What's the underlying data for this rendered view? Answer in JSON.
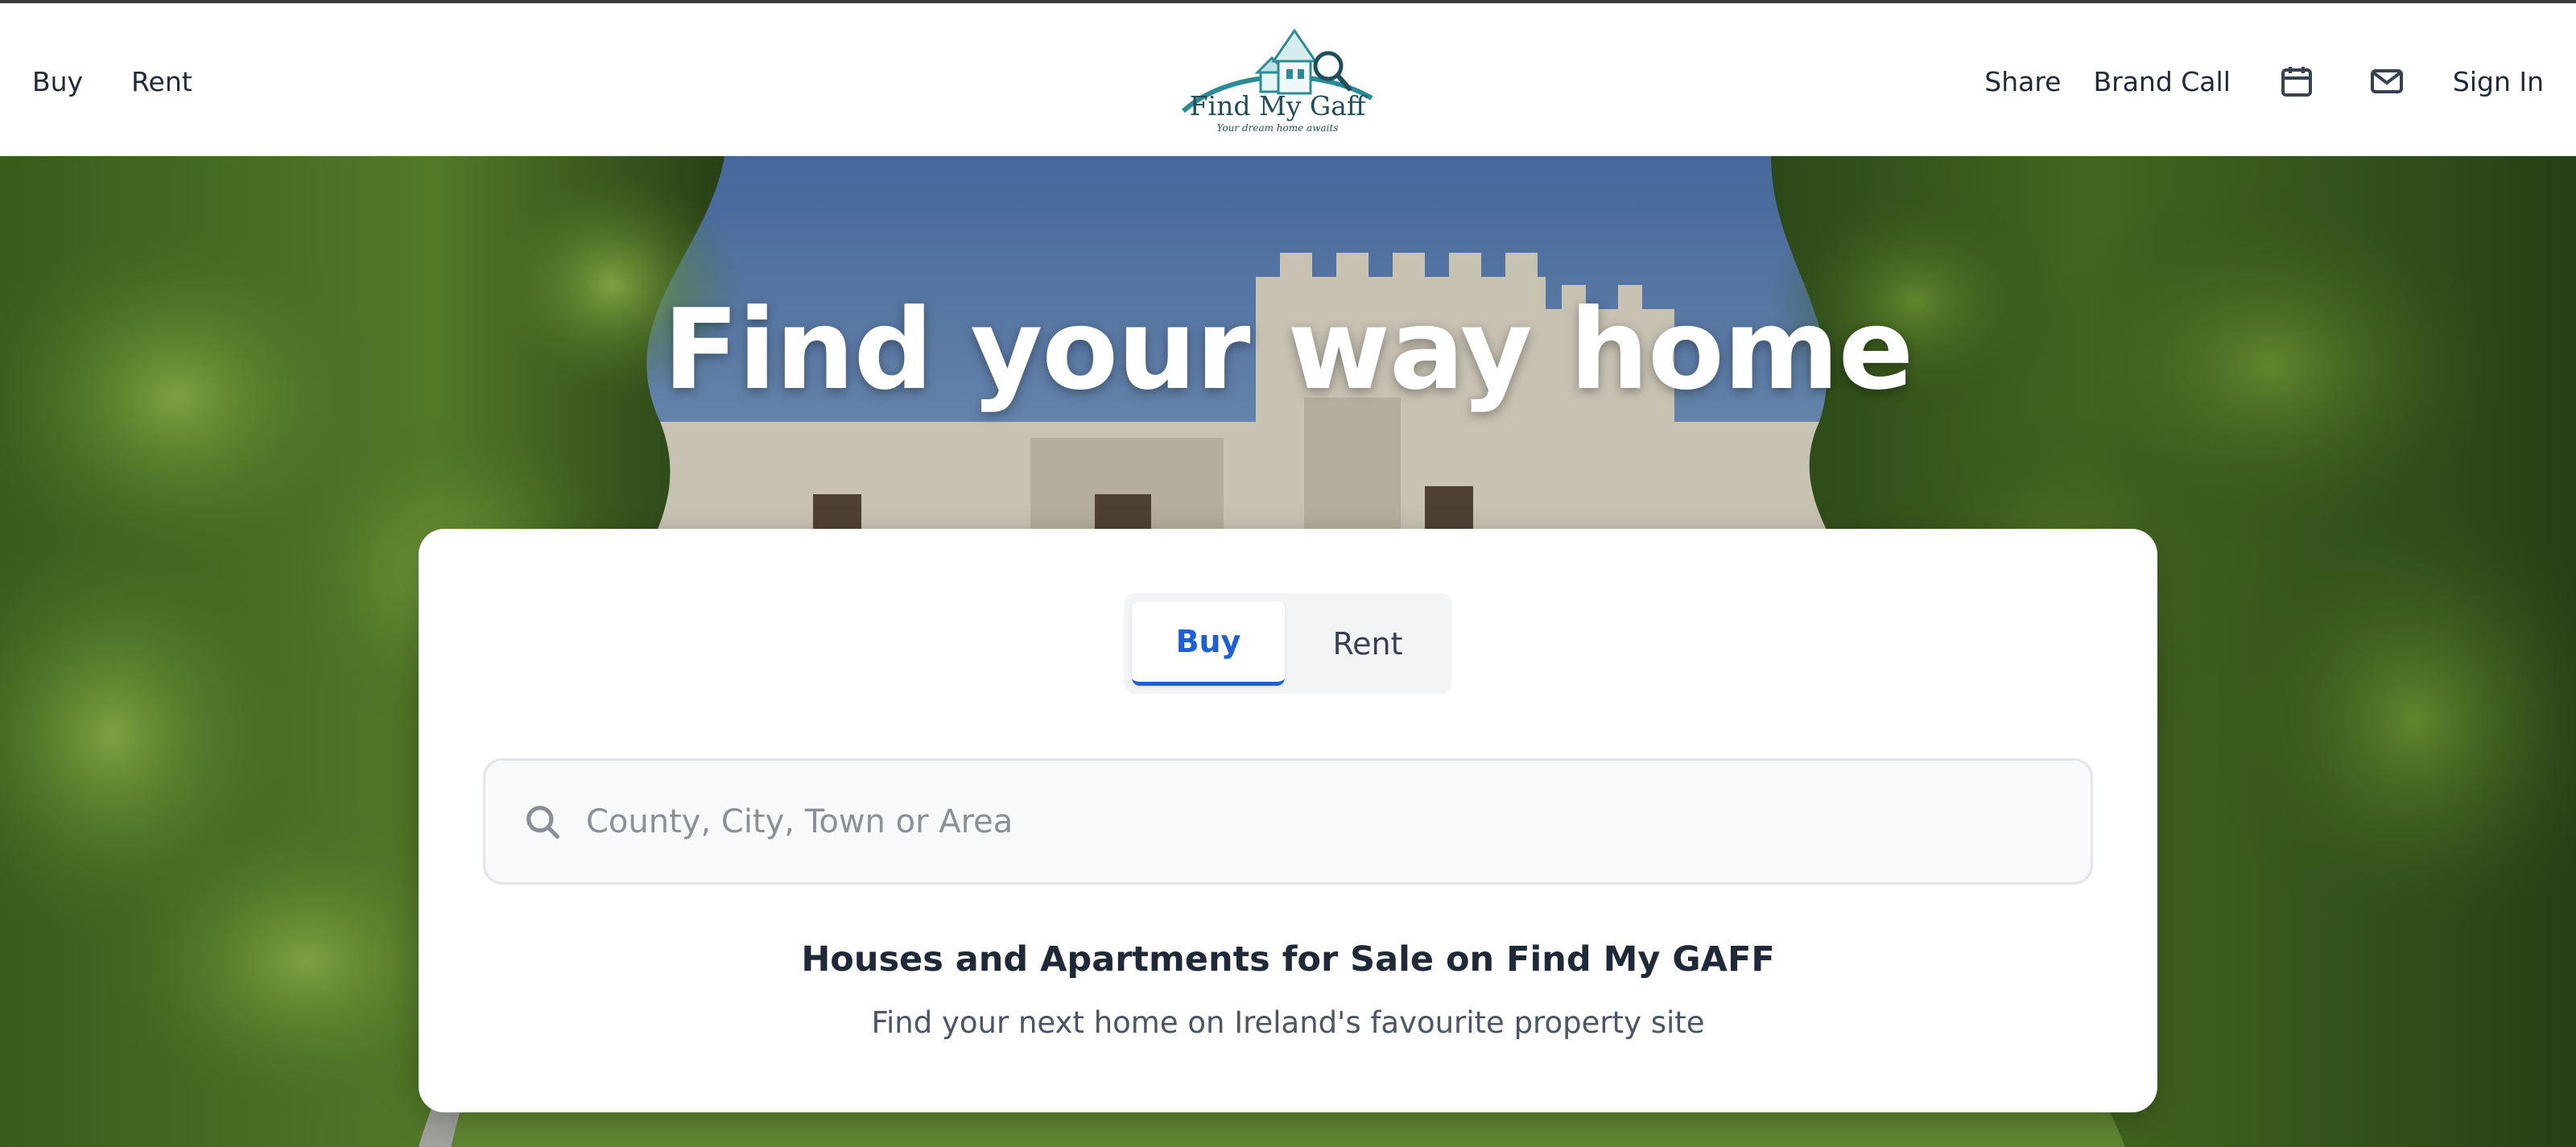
{
  "header": {
    "nav_left": [
      "Buy",
      "Rent"
    ],
    "logo": {
      "name": "Find My Gaff",
      "tagline": "Your dream home awaits"
    },
    "nav_right": {
      "share": "Share",
      "brand_call": "Brand Call",
      "sign_in": "Sign In"
    },
    "icons": [
      "calendar-icon",
      "mail-icon"
    ]
  },
  "hero": {
    "title": "Find your way home"
  },
  "search_card": {
    "tabs": [
      {
        "label": "Buy",
        "active": true
      },
      {
        "label": "Rent",
        "active": false
      }
    ],
    "search_placeholder": "County, City, Town or Area",
    "search_value": "",
    "heading": "Houses and Apartments for Sale on Find My GAFF",
    "subheading": "Find your next home on Ireland's favourite property site"
  },
  "colors": {
    "accent": "#1d5fd6",
    "logo_teal": "#2a8c94",
    "logo_text": "#1f4f5c"
  }
}
